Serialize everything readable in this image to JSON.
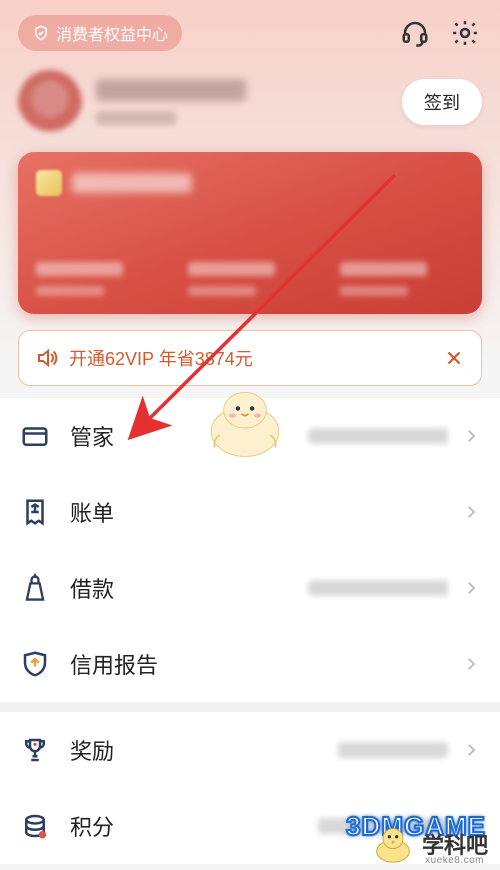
{
  "header": {
    "rights_center_label": "消费者权益中心"
  },
  "profile": {
    "checkin_label": "签到"
  },
  "vip_banner": {
    "text": "开通62VIP 年省3874元"
  },
  "menu": {
    "items": [
      {
        "key": "guanjia",
        "label": "管家",
        "icon": "card-icon",
        "has_blur": true
      },
      {
        "key": "zhangdan",
        "label": "账单",
        "icon": "receipt-icon",
        "has_blur": false
      },
      {
        "key": "jiekuan",
        "label": "借款",
        "icon": "wallet-icon",
        "has_blur": true
      },
      {
        "key": "xinyong",
        "label": "信用报告",
        "icon": "shield-icon",
        "has_blur": false
      },
      {
        "key": "jiangli",
        "label": "奖励",
        "icon": "trophy-icon",
        "has_blur": true
      },
      {
        "key": "jifen",
        "label": "积分",
        "icon": "coins-icon",
        "has_blur": true
      }
    ]
  },
  "watermark": {
    "brand1": "3DMGAME",
    "brand2": "学科吧",
    "brand2_sub": "xueke8.com"
  },
  "colors": {
    "accent_red": "#d74e43",
    "vip_orange": "#d25b2e",
    "icon_navy": "#2d3e5e"
  }
}
